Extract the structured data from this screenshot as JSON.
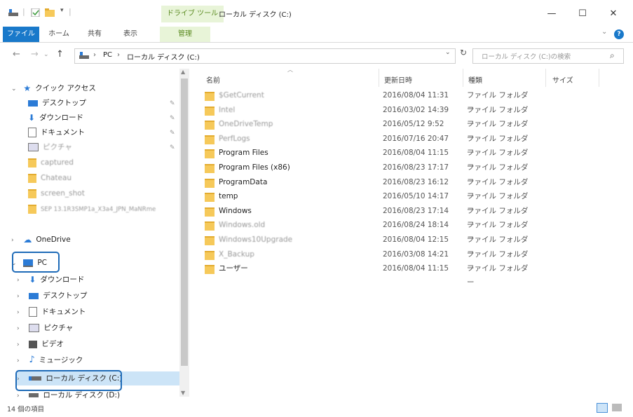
{
  "title": {
    "drive_tools": "ドライブ ツール",
    "window_title": "ローカル ディスク (C:)",
    "minimize": "—",
    "maximize": "☐",
    "close": "✕"
  },
  "ribbon": {
    "tabs": [
      "ファイル",
      "ホーム",
      "共有",
      "表示",
      "管理"
    ],
    "expand": "⌄",
    "help": "?"
  },
  "address": {
    "back": "←",
    "forward": "→",
    "up": "↑",
    "sep": "›",
    "pc": "PC",
    "drive": "ローカル ディスク (C:)",
    "dropdown": "⌄",
    "refresh": "↻",
    "search_placeholder": "ローカル ディスク (C:)の検索",
    "search_icon": "⌕"
  },
  "nav": {
    "quick_access": "クイック アクセス",
    "quick_items": [
      "デスクトップ",
      "ダウンロード",
      "ドキュメント",
      "ピクチャ"
    ],
    "folders": [
      "captured",
      "Chateau",
      "screen_shot",
      "SEP 13.1R3SMP1a_X3a4_JPN_MaNRme"
    ],
    "onedrive": "OneDrive",
    "pc": "PC",
    "pc_items": [
      "ダウンロード",
      "デスクトップ",
      "ドキュメント",
      "ピクチャ",
      "ビデオ",
      "ミュージック",
      "ローカル ディスク (C:)",
      "ローカル ディスク (D:)"
    ],
    "pin": "📌",
    "chevron_right": "›",
    "chevron_down": "⌄"
  },
  "columns": {
    "name": "名前",
    "date": "更新日時",
    "type": "種類",
    "size": "サイズ"
  },
  "files": [
    {
      "name": "$GetCurrent",
      "date": "2016/08/04 11:31",
      "type": "ファイル フォルダー",
      "blurred": true
    },
    {
      "name": "Intel",
      "date": "2016/03/02 14:39",
      "type": "ファイル フォルダー",
      "blurred": true
    },
    {
      "name": "OneDriveTemp",
      "date": "2016/05/12 9:52",
      "type": "ファイル フォルダー",
      "blurred": true
    },
    {
      "name": "PerfLogs",
      "date": "2016/07/16 20:47",
      "type": "ファイル フォルダー",
      "blurred": true
    },
    {
      "name": "Program Files",
      "date": "2016/08/04 11:15",
      "type": "ファイル フォルダー",
      "blurred": false
    },
    {
      "name": "Program Files (x86)",
      "date": "2016/08/23 17:17",
      "type": "ファイル フォルダー",
      "blurred": false
    },
    {
      "name": "ProgramData",
      "date": "2016/08/23 16:12",
      "type": "ファイル フォルダー",
      "blurred": false
    },
    {
      "name": "temp",
      "date": "2016/05/10 14:17",
      "type": "ファイル フォルダー",
      "blurred": false
    },
    {
      "name": "Windows",
      "date": "2016/08/23 17:14",
      "type": "ファイル フォルダー",
      "blurred": false
    },
    {
      "name": "Windows.old",
      "date": "2016/08/24 18:14",
      "type": "ファイル フォルダー",
      "blurred": true
    },
    {
      "name": "Windows10Upgrade",
      "date": "2016/08/04 12:15",
      "type": "ファイル フォルダー",
      "blurred": true
    },
    {
      "name": "X_Backup",
      "date": "2016/03/08 14:21",
      "type": "ファイル フォルダー",
      "blurred": true
    },
    {
      "name": "ユーザー",
      "date": "2016/08/04 11:15",
      "type": "ファイル フォルダー",
      "blurred": false
    }
  ],
  "status": "14 個の項目",
  "colors": {
    "accent": "#1979ca",
    "drive_tools_bg": "#e8f4d8",
    "folder": "#f6c95a",
    "highlight_box": "#1e6bb8"
  }
}
